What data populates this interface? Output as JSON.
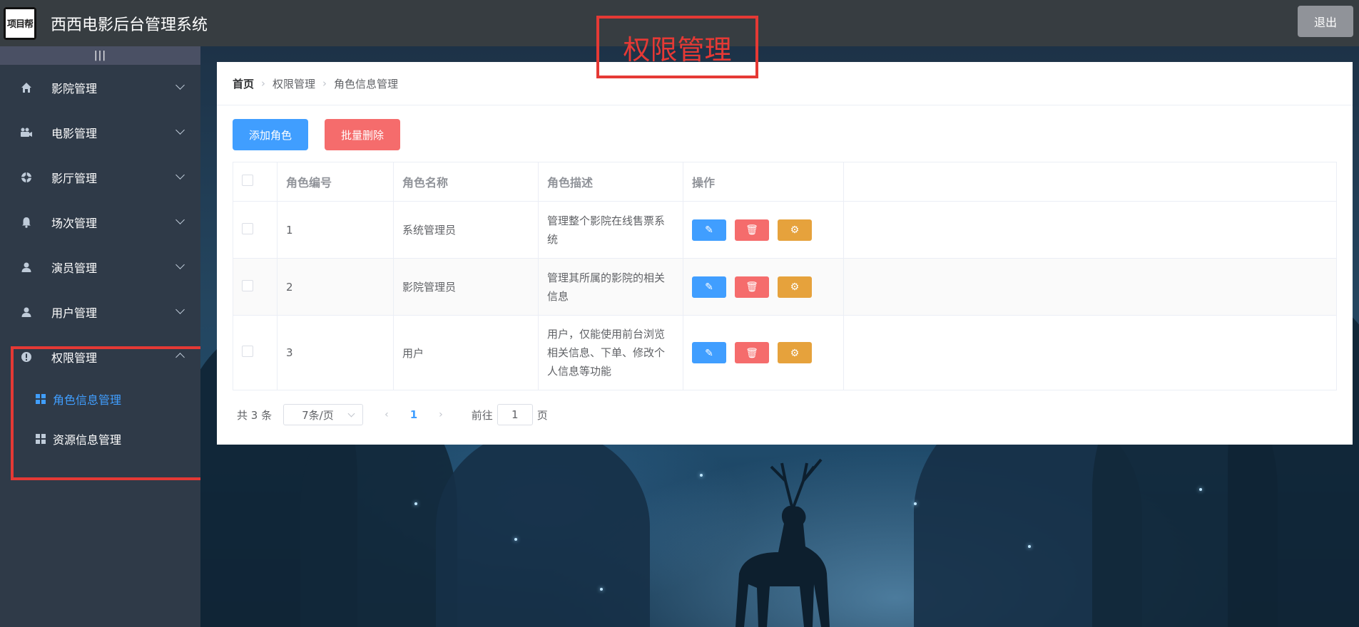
{
  "header": {
    "logo_text": "项目帮",
    "title": "西西电影后台管理系统",
    "logout_label": "退出"
  },
  "sidebar": {
    "collapse_glyph": "|||",
    "items": [
      {
        "label": "影院管理",
        "icon": "home-icon"
      },
      {
        "label": "电影管理",
        "icon": "video-camera-icon"
      },
      {
        "label": "影厅管理",
        "icon": "aperture-icon"
      },
      {
        "label": "场次管理",
        "icon": "bell-icon"
      },
      {
        "label": "演员管理",
        "icon": "user-icon"
      },
      {
        "label": "用户管理",
        "icon": "user-icon"
      },
      {
        "label": "权限管理",
        "icon": "warning-icon",
        "expanded": true
      }
    ],
    "sub_items": [
      {
        "label": "角色信息管理",
        "active": true
      },
      {
        "label": "资源信息管理",
        "active": false
      }
    ]
  },
  "annotation": {
    "text": "权限管理",
    "color": "#e53935"
  },
  "breadcrumb": [
    "首页",
    "权限管理",
    "角色信息管理"
  ],
  "toolbar": {
    "add_label": "添加角色",
    "batch_delete_label": "批量删除"
  },
  "table": {
    "headers": [
      "角色编号",
      "角色名称",
      "角色描述",
      "操作"
    ],
    "rows": [
      {
        "id": "1",
        "name": "系统管理员",
        "desc": "管理整个影院在线售票系统"
      },
      {
        "id": "2",
        "name": "影院管理员",
        "desc": "管理其所属的影院的相关信息"
      },
      {
        "id": "3",
        "name": "用户",
        "desc": "用户，仅能使用前台浏览相关信息、下单、修改个人信息等功能"
      }
    ]
  },
  "pagination": {
    "total_text": "共 3 条",
    "page_size": "7条/页",
    "current_page": "1",
    "goto_label": "前往",
    "goto_value": "1",
    "page_unit": "页"
  },
  "colors": {
    "primary": "#409eff",
    "danger": "#f56c6c",
    "warning": "#e6a23c",
    "sidebar": "#2f3a48",
    "header": "#373d41"
  }
}
